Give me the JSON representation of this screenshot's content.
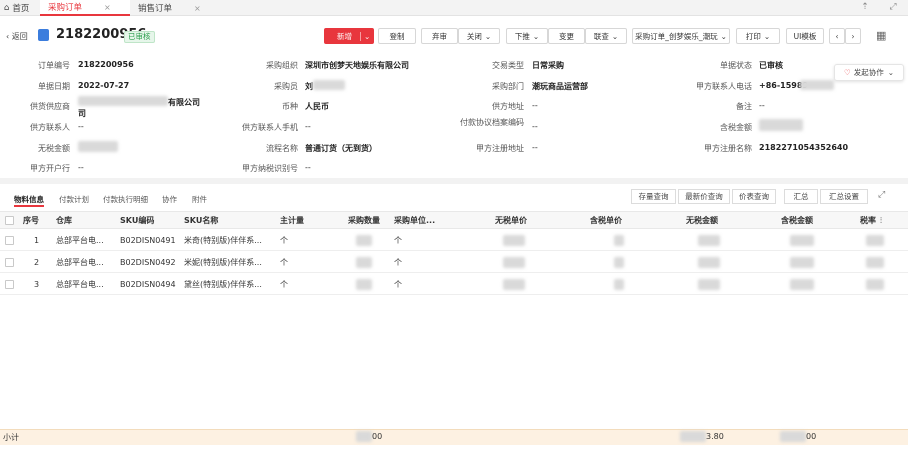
{
  "tabs": {
    "home": "首页",
    "purchase_order": "采购订单",
    "sales_order": "销售订单"
  },
  "header": {
    "back": "返回",
    "order_no": "2182200956",
    "status_badge": "已审核",
    "buttons": {
      "new": "新增",
      "register": "登制",
      "abandon": "弃审",
      "close": "关闭",
      "push_down": "下推",
      "change": "变更",
      "link_query": "联查",
      "print_template": "采购订单_创梦娱乐_潮玩",
      "print": "打印",
      "ui_template": "UI模板"
    },
    "collaborate": "发起协作"
  },
  "form": {
    "order_no_label": "订单编号",
    "order_no": "2182200956",
    "purchase_org_label": "采购组织",
    "purchase_org": "深圳市创梦天地娱乐有限公司",
    "trade_type_label": "交易类型",
    "trade_type": "日常采购",
    "doc_status_label": "单据状态",
    "doc_status": "已审核",
    "doc_date_label": "单据日期",
    "doc_date": "2022-07-27",
    "buyer_label": "采购员",
    "buyer": "刘",
    "purchase_dept_label": "采购部门",
    "purchase_dept": "潮玩商品运营部",
    "party_a_phone_label": "甲方联系人电话",
    "party_a_phone": "+86-15989",
    "supplier_label": "供货供应商",
    "supplier": "有限公司",
    "currency_label": "币种",
    "currency": "人民币",
    "supplier_address_label": "供方地址",
    "supplier_address": "--",
    "remark_label": "备注",
    "remark": "--",
    "supplier_contact_label": "供方联系人",
    "supplier_contact": "--",
    "supplier_contact_phone_label": "供方联系人手机",
    "supplier_contact_phone": "--",
    "payment_archive_label": "付款协议档案编码",
    "payment_archive": "--",
    "tax_incl_amount_label": "含税金额",
    "tax_excl_amount_label": "无税金额",
    "process_label": "流程名称",
    "process": "普通订货（无到货）",
    "party_a_reg_address_label": "甲方注册地址",
    "party_a_reg_address": "--",
    "party_a_reg_name_label": "甲方注册名称",
    "party_a_reg_name": "2182271054352640",
    "party_a_bank_label": "甲方开户行",
    "party_a_bank": "--",
    "party_a_tax_no_label": "甲方纳税识别号",
    "party_a_tax_no": "--"
  },
  "subtabs": [
    "物料信息",
    "付款计划",
    "付款执行明细",
    "协作",
    "附件"
  ],
  "grid_buttons": [
    "存量查询",
    "最新价查询",
    "价表查询",
    "汇总",
    "汇总设置"
  ],
  "table": {
    "headers": [
      "序号",
      "仓库",
      "SKU编码",
      "SKU名称",
      "主计量",
      "采购数量",
      "采购单位...",
      "无税单价",
      "含税单价",
      "无税金额",
      "含税金额",
      "税率"
    ],
    "rows": [
      {
        "seq": "1",
        "warehouse": "总部平台电...",
        "sku": "B02DISN0491",
        "name": "米奇(特别版)伴伴系...",
        "unit": "个",
        "purchase_unit": "个"
      },
      {
        "seq": "2",
        "warehouse": "总部平台电...",
        "sku": "B02DISN0492",
        "name": "米妮(特别版)伴伴系...",
        "unit": "个",
        "purchase_unit": "个"
      },
      {
        "seq": "3",
        "warehouse": "总部平台电...",
        "sku": "B02DISN0494",
        "name": "黛丝(特别版)伴伴系...",
        "unit": "个",
        "purchase_unit": "个"
      }
    ]
  },
  "footer": {
    "subtotal_label": "小计",
    "qty_suffix": "00",
    "tax_excl_suffix": "3.80",
    "tax_incl_suffix": "00"
  },
  "colors": {
    "accent": "#e8363d",
    "approved": "#2a9d4b"
  }
}
